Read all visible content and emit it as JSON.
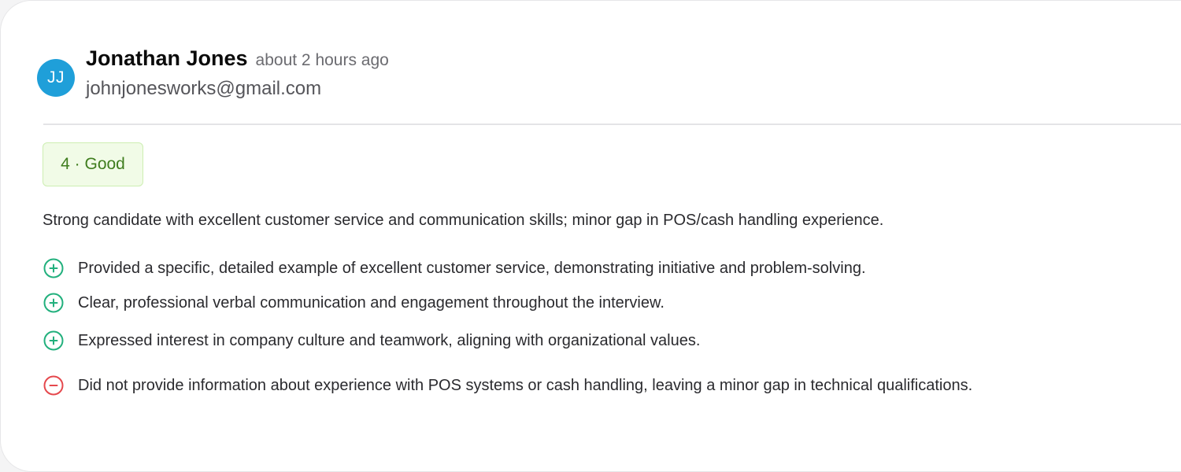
{
  "reviewer": {
    "initials": "JJ",
    "name": "Jonathan Jones",
    "time_ago": "about 2 hours ago",
    "email": "johnjonesworks@gmail.com",
    "avatar_color": "#1f9fd9"
  },
  "score": {
    "label": "4 · Good",
    "value": 4,
    "rating": "Good"
  },
  "summary": "Strong candidate with excellent customer service and communication skills; minor gap in POS/cash handling experience.",
  "strengths": [
    {
      "text": "Provided a specific, detailed example of excellent customer service, demonstrating initiative and problem-solving.",
      "icon": "plus-circle-icon"
    },
    {
      "text": "Clear, professional verbal communication and engagement throughout the interview.",
      "icon": "plus-circle-icon"
    },
    {
      "text": "Expressed interest in company culture and teamwork, aligning with organizational values.",
      "icon": "plus-circle-icon"
    }
  ],
  "weaknesses": [
    {
      "text": "Did not provide information about experience with POS systems or cash handling, leaving a minor gap in technical qualifications.",
      "icon": "minus-circle-icon"
    }
  ],
  "colors": {
    "positive": "#22b07d",
    "negative": "#e5484d",
    "badge_text": "#3f7d1e",
    "badge_bg": "#f1fbe7"
  }
}
